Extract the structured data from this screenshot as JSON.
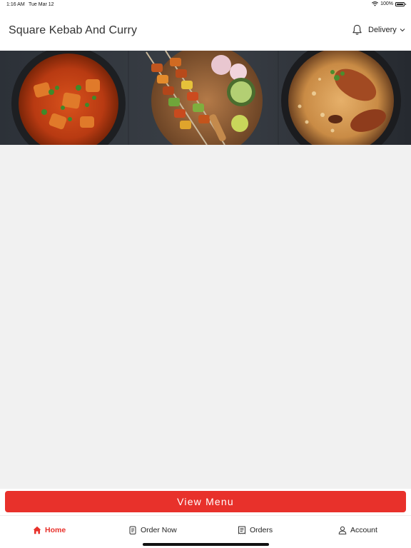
{
  "status_bar": {
    "time": "1:16 AM",
    "date": "Tue Mar 12",
    "battery": "100%"
  },
  "header": {
    "title": "Square Kebab And Curry",
    "delivery_label": "Delivery"
  },
  "banner": {
    "image": "food-banner"
  },
  "actions": {
    "view_menu_label": "View Menu"
  },
  "bottom_nav": {
    "items": [
      {
        "label": "Home",
        "icon": "home-icon",
        "active": true
      },
      {
        "label": "Order Now",
        "icon": "order-icon",
        "active": false
      },
      {
        "label": "Orders",
        "icon": "receipt-icon",
        "active": false
      },
      {
        "label": "Account",
        "icon": "person-icon",
        "active": false
      }
    ]
  },
  "colors": {
    "accent": "#e8312b",
    "background": "#f1f1f1"
  }
}
